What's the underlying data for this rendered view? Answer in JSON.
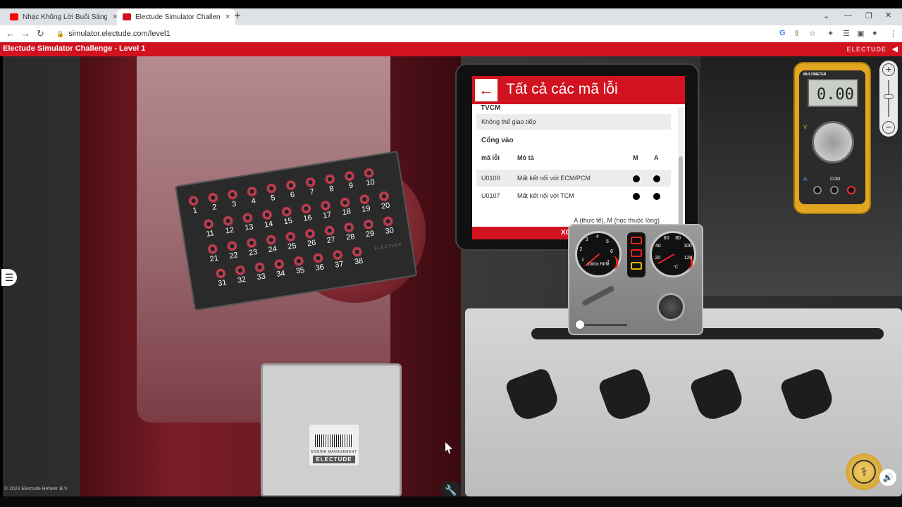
{
  "browser": {
    "tabs": [
      {
        "label": "Nhạc Không Lời Buổi Sáng Tinh Th...",
        "icon_color": "#ff0000"
      },
      {
        "label": "Electude Simulator Challenge - L...",
        "icon_color": "#d2121f"
      }
    ],
    "address": "simulator.electude.com/level1",
    "new_tab_symbol": "+",
    "close_symbol": "×"
  },
  "app": {
    "title": "Electude Simulator Challenge - Level 1",
    "brand": "ELECTUDE",
    "accent_color": "#d2121f"
  },
  "fault_panel": {
    "title": "Tất cả các mã lỗi",
    "top_section": "TVCM",
    "note": "Không thể giao tiếp",
    "section": "Cổng vào",
    "columns": [
      "mã lỗi",
      "Mô tả",
      "M",
      "A"
    ],
    "rows": [
      {
        "code": "U0100",
        "desc": "Mất kết nối với ECM/PCM",
        "m": true,
        "a": true
      },
      {
        "code": "U0107",
        "desc": "Mất kết nối với TCM",
        "m": true,
        "a": true
      }
    ],
    "legend": "A (thực tế), M (học thuộc lòng)",
    "footer_button": "XO"
  },
  "pinboard": {
    "pins": [
      "1",
      "2",
      "3",
      "4",
      "5",
      "6",
      "7",
      "8",
      "9",
      "10",
      "11",
      "12",
      "13",
      "14",
      "15",
      "16",
      "17",
      "18",
      "19",
      "20",
      "21",
      "22",
      "23",
      "24",
      "25",
      "26",
      "27",
      "28",
      "29",
      "30",
      "31",
      "32",
      "33",
      "34",
      "35",
      "36",
      "37",
      "38"
    ],
    "brand": "ELECTUDE"
  },
  "dashboard": {
    "rpm_marks": [
      "1",
      "2",
      "3",
      "4",
      "5",
      "6",
      "7"
    ],
    "rpm_unit": "1000x RPM",
    "temp_marks": [
      "20",
      "40",
      "60",
      "80",
      "100",
      "120"
    ],
    "temp_unit": "°C",
    "warning_colors": [
      "#e2221e",
      "#e2221e",
      "#e6b800"
    ]
  },
  "multimeter": {
    "brand": "MULTIMETER",
    "reading": "0.00",
    "com_label": "COM",
    "v_label": "V",
    "a_label": "A"
  },
  "ecu": {
    "subtitle": "ENGINE MANAGEMENT",
    "brand": "ELECTUDE"
  },
  "copyright": "© 2023 Electude Beheer B.V.",
  "controls": {
    "zoom_in": "+",
    "zoom_out": "−",
    "side_menu_symbol": "☰",
    "wrench_symbol": "🔧",
    "sound_symbol": "🔊",
    "tool_symbol": "⚕"
  }
}
